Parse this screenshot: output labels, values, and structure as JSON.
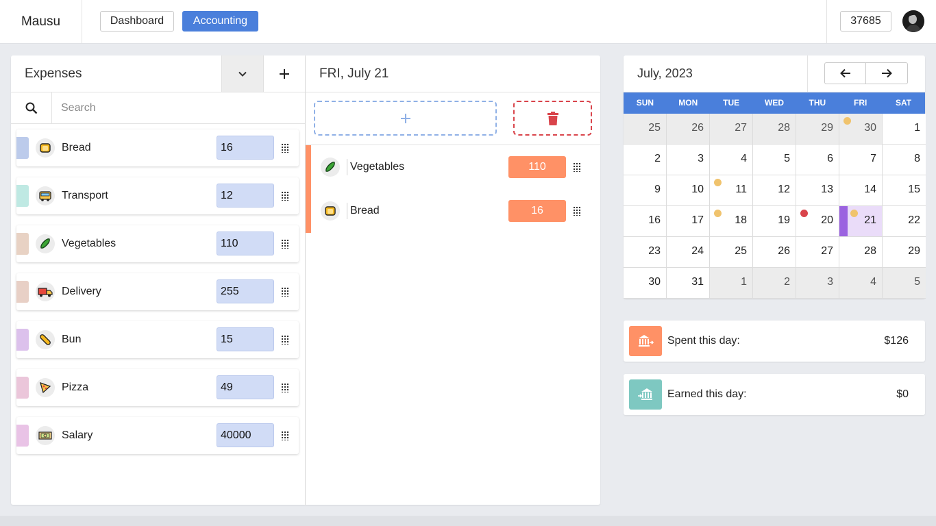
{
  "header": {
    "brand": "Mausu",
    "nav": {
      "dashboard": "Dashboard",
      "accounting": "Accounting"
    },
    "balance": "37685"
  },
  "categories": {
    "title": "Expenses",
    "search_placeholder": "Search",
    "items": [
      {
        "label": "Bread",
        "value": "16",
        "color": "#bccbeb",
        "icon": "bread-icon"
      },
      {
        "label": "Transport",
        "value": "12",
        "color": "#bfe9e3",
        "icon": "bus-icon"
      },
      {
        "label": "Vegetables",
        "value": "110",
        "color": "#e8d2c4",
        "icon": "cucumber-icon"
      },
      {
        "label": "Delivery",
        "value": "255",
        "color": "#e8d0c6",
        "icon": "truck-icon"
      },
      {
        "label": "Bun",
        "value": "15",
        "color": "#dcc1ec",
        "icon": "bun-icon"
      },
      {
        "label": "Pizza",
        "value": "49",
        "color": "#ebc6da",
        "icon": "pizza-icon"
      },
      {
        "label": "Salary",
        "value": "40000",
        "color": "#e9c3e6",
        "icon": "banknote-icon"
      }
    ]
  },
  "day": {
    "title": "FRI, July 21",
    "transactions": [
      {
        "label": "Vegetables",
        "amount": "110",
        "icon": "cucumber-icon"
      },
      {
        "label": "Bread",
        "amount": "16",
        "icon": "bread-icon"
      }
    ],
    "accent": "#ff9166"
  },
  "calendar": {
    "title": "July, 2023",
    "weekdays": [
      "SUN",
      "MON",
      "TUE",
      "WED",
      "THU",
      "FRI",
      "SAT"
    ],
    "weeks": [
      [
        {
          "d": "25",
          "o": true
        },
        {
          "d": "26",
          "o": true
        },
        {
          "d": "27",
          "o": true
        },
        {
          "d": "28",
          "o": true
        },
        {
          "d": "29",
          "o": true
        },
        {
          "d": "30",
          "o": true,
          "dot": "#f0c36d"
        },
        {
          "d": "1"
        }
      ],
      [
        {
          "d": "2"
        },
        {
          "d": "3"
        },
        {
          "d": "4"
        },
        {
          "d": "5"
        },
        {
          "d": "6"
        },
        {
          "d": "7"
        },
        {
          "d": "8"
        }
      ],
      [
        {
          "d": "9"
        },
        {
          "d": "10"
        },
        {
          "d": "11",
          "dot": "#f0c36d"
        },
        {
          "d": "12"
        },
        {
          "d": "13"
        },
        {
          "d": "14"
        },
        {
          "d": "15"
        }
      ],
      [
        {
          "d": "16"
        },
        {
          "d": "17"
        },
        {
          "d": "18",
          "dot": "#f0c36d"
        },
        {
          "d": "19"
        },
        {
          "d": "20",
          "dot": "#d9444b"
        },
        {
          "d": "21",
          "dot": "#f0c36d",
          "selected": true
        },
        {
          "d": "22"
        }
      ],
      [
        {
          "d": "23"
        },
        {
          "d": "24"
        },
        {
          "d": "25"
        },
        {
          "d": "26"
        },
        {
          "d": "27"
        },
        {
          "d": "28"
        },
        {
          "d": "29"
        }
      ],
      [
        {
          "d": "30"
        },
        {
          "d": "31"
        },
        {
          "d": "1",
          "o": true
        },
        {
          "d": "2",
          "o": true
        },
        {
          "d": "3",
          "o": true
        },
        {
          "d": "4",
          "o": true
        },
        {
          "d": "5",
          "o": true
        }
      ]
    ]
  },
  "summary": {
    "spent": {
      "label": "Spent this day:",
      "value": "$126",
      "color": "#ff9166"
    },
    "earned": {
      "label": "Earned this day:",
      "value": "$0",
      "color": "#7ec8c1"
    }
  }
}
